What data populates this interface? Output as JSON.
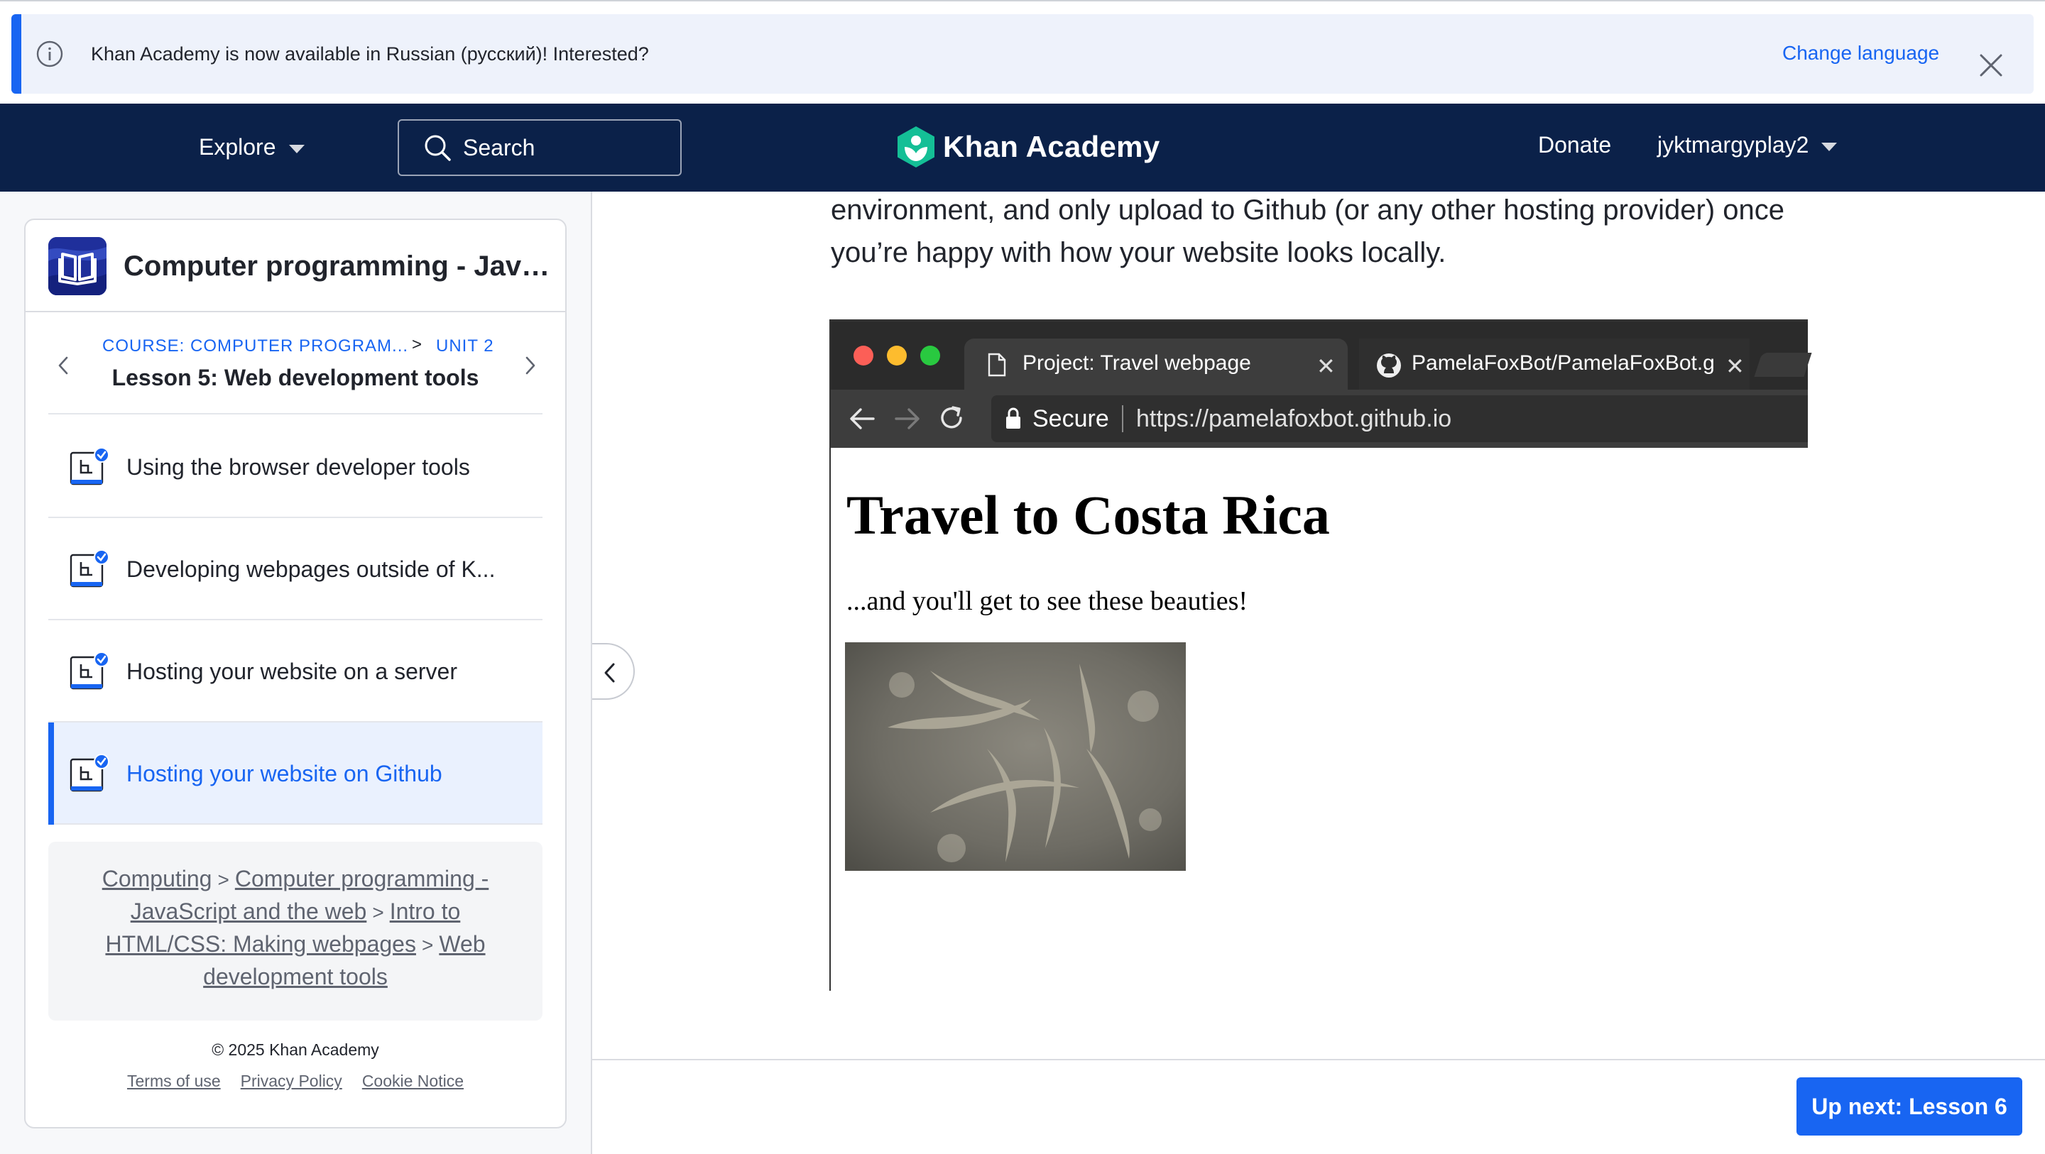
{
  "banner": {
    "message": "Khan Academy is now available in Russian (русский)! Interested?",
    "action_label": "Change language"
  },
  "header": {
    "explore_label": "Explore",
    "search_label": "Search",
    "logo_text": "Khan Academy",
    "donate_label": "Donate",
    "username": "jyktmargyplay2"
  },
  "sidebar": {
    "course_title": "Computer programming - JavaScr...",
    "crumb_course": "COURSE: COMPUTER PROGRAM...",
    "crumb_separator": ">",
    "crumb_unit": "UNIT 2",
    "lesson_title": "Lesson 5: Web development tools",
    "items": [
      {
        "label": "Using the browser developer tools",
        "active": false
      },
      {
        "label": "Developing webpages outside of K...",
        "active": false
      },
      {
        "label": "Hosting your website on a server",
        "active": false
      },
      {
        "label": "Hosting your website on Github",
        "active": true
      }
    ],
    "breadcrumb": [
      "Computing",
      "Computer programming - JavaScript and the web",
      "Intro to HTML/CSS: Making webpages",
      "Web development tools"
    ],
    "breadcrumb_separator": ">",
    "copyright": "© 2025 Khan Academy",
    "footer_links": [
      "Terms of use",
      "Privacy Policy",
      "Cookie Notice"
    ]
  },
  "article": {
    "text": "environment, and only upload to Github (or any other hosting provider) once you’re happy with how your website looks locally."
  },
  "embedded_screenshot": {
    "tab1_title": "Project: Travel webpage",
    "tab2_title": "PamelaFoxBot/PamelaFoxBot.g",
    "tab_close": "✕",
    "secure_label": "Secure",
    "url": "https://pamelafoxbot.github.io",
    "heading": "Travel to Costa Rica",
    "paragraph": "...and you'll get to see these beauties!"
  },
  "bottom": {
    "up_next_label": "Up next: Lesson 6"
  },
  "colors": {
    "accent": "#1865f2",
    "header_bg": "#0b2149",
    "banner_bg": "#eef2fb",
    "logo_green": "#14bf96"
  },
  "icons": [
    "info-icon",
    "close-icon",
    "chevron-down-icon",
    "search-icon",
    "khan-logo-icon",
    "book-icon",
    "chevron-left-icon",
    "chevron-right-icon",
    "article-check-icon",
    "collapse-chevron-icon",
    "lock-icon",
    "reload-icon",
    "back-arrow-icon",
    "forward-arrow-icon",
    "github-icon",
    "document-icon"
  ]
}
